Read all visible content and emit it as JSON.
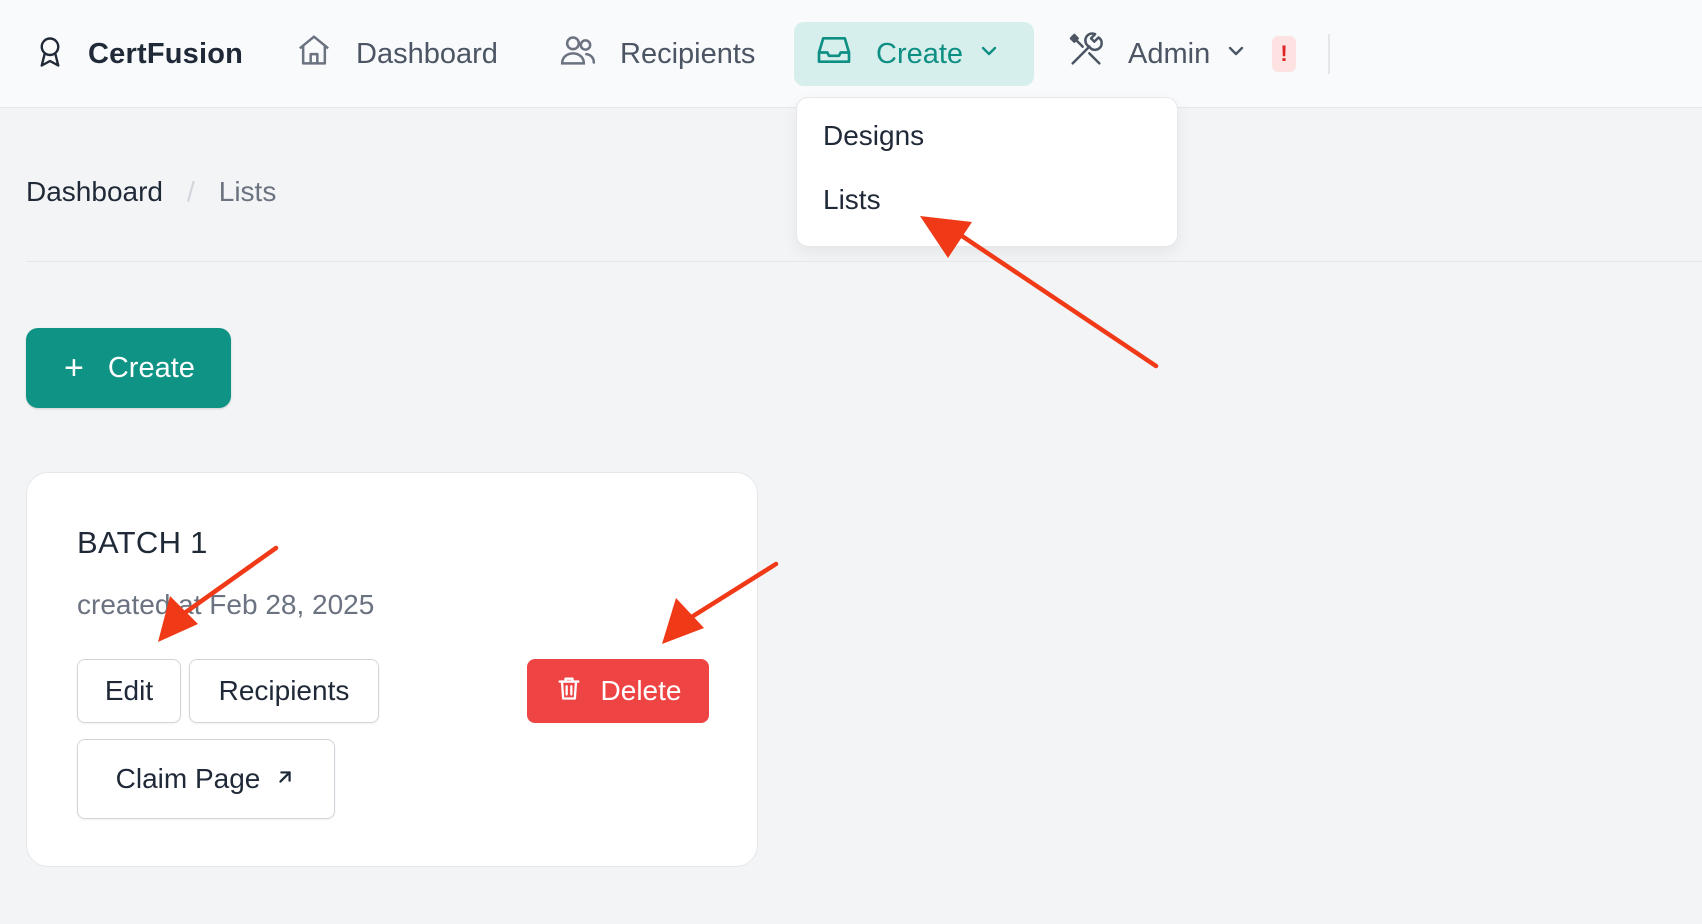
{
  "brand": {
    "name": "CertFusion",
    "icon": "award-ribbon-icon"
  },
  "nav": {
    "dashboard": "Dashboard",
    "recipients": "Recipients",
    "create": "Create",
    "admin": "Admin",
    "alert": "!"
  },
  "create_menu": {
    "items": [
      "Designs",
      "Lists"
    ]
  },
  "breadcrumb": {
    "home": "Dashboard",
    "separator": "/",
    "current": "Lists"
  },
  "page": {
    "create_button": "Create",
    "create_plus": "+"
  },
  "list_card": {
    "title": "BATCH 1",
    "created": "created at Feb 28, 2025",
    "buttons": {
      "edit": "Edit",
      "recipients": "Recipients",
      "delete": "Delete",
      "claim_page": "Claim Page"
    }
  },
  "colors": {
    "accent": "#0e9384",
    "accent_soft": "#d7efec",
    "danger": "#ef4444",
    "annotation_arrow": "#f03a17",
    "background": "#f3f4f6"
  }
}
